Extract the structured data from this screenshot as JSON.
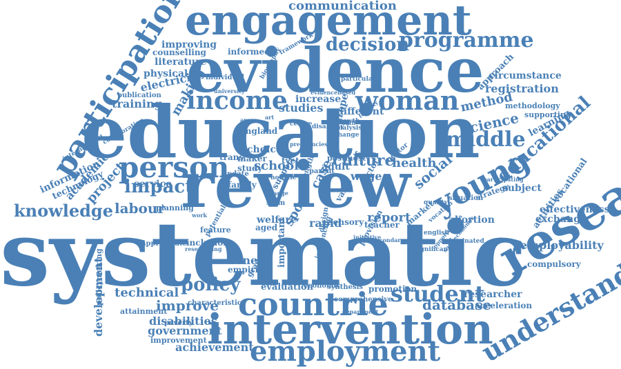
{
  "colors": {
    "word": "#4a80b6",
    "background": "#ffffff"
  },
  "words": [
    "systematic",
    "education",
    "review",
    "evidence",
    "intervention",
    "engagement",
    "research",
    "countrie",
    "employment",
    "participation",
    "income",
    "woman",
    "young",
    "person",
    "understanding",
    "programme",
    "decision",
    "knowledge",
    "impact",
    "student",
    "communication",
    "middle",
    "policy",
    "labour",
    "educational",
    "registration",
    "science",
    "social",
    "method",
    "culture",
    "school",
    "technical",
    "database",
    "improve",
    "employability",
    "disabilities",
    "government",
    "achievement",
    "development",
    "researcher",
    "effectiveness",
    "exchange",
    "abortion",
    "report",
    "health",
    "circumstance",
    "electricity",
    "training",
    "physical",
    "literature",
    "improving",
    "informed",
    "studies",
    "making",
    "project",
    "academic",
    "information",
    "technology",
    "service",
    "case",
    "wage",
    "adult",
    "benefit",
    "welfare",
    "rapid",
    "sport",
    "subject",
    "activities",
    "vocational",
    "approach",
    "learning",
    "methodology",
    "supporting",
    "strategy",
    "evaluation",
    "promotion",
    "acceleration",
    "compulsory",
    "attainment",
    "improvement",
    "empirical",
    "inclusion",
    "planning",
    "feature",
    "different",
    "increase",
    "england",
    "choice",
    "maker",
    "tvet",
    "europe",
    "aged",
    "framework",
    "counselling",
    "publication",
    "international",
    "collaboration",
    "policymaking",
    "characteristic",
    "graduate",
    "sensory",
    "teacher",
    "market",
    "economic",
    "synthesis",
    "comprehensive",
    "department",
    "appropriate",
    "poverty",
    "researching",
    "potential",
    "individual",
    "university",
    "particular",
    "biography",
    "dominated",
    "situation",
    "participating",
    "vocation",
    "sector",
    "provision",
    "important",
    "influencing",
    "initiative",
    "design",
    "value",
    "significant",
    "quality",
    "english",
    "growth",
    "analysis",
    "change",
    "secondary",
    "opportunities",
    "socioeconomic",
    "holistic",
    "factor",
    "centre",
    "strength",
    "evidencebased",
    "pregnancies",
    "fertility",
    "trans",
    "update",
    "family",
    "study",
    "support",
    "post",
    "most",
    "stem",
    "range",
    "work",
    "disability",
    "mentor",
    "skill",
    "parent",
    "art",
    "areas",
    "content"
  ]
}
